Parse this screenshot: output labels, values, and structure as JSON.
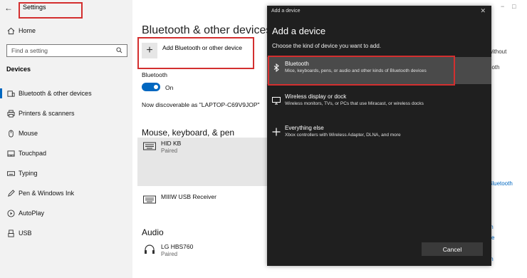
{
  "sidebar": {
    "back_glyph": "←",
    "app_title": "Settings",
    "home": {
      "label": "Home",
      "icon": "home-icon"
    },
    "search": {
      "placeholder": "Find a setting",
      "icon": "search-icon"
    },
    "section_title": "Devices",
    "items": [
      {
        "label": "Bluetooth & other devices",
        "icon": "bluetooth-devices-icon"
      },
      {
        "label": "Printers & scanners",
        "icon": "printer-icon"
      },
      {
        "label": "Mouse",
        "icon": "mouse-icon"
      },
      {
        "label": "Touchpad",
        "icon": "touchpad-icon"
      },
      {
        "label": "Typing",
        "icon": "keyboard-icon"
      },
      {
        "label": "Pen & Windows Ink",
        "icon": "pen-icon"
      },
      {
        "label": "AutoPlay",
        "icon": "autoplay-icon"
      },
      {
        "label": "USB",
        "icon": "usb-icon"
      }
    ]
  },
  "main": {
    "title": "Bluetooth & other devices",
    "add_device_label": "Add Bluetooth or other device",
    "bluetooth_label": "Bluetooth",
    "toggle_state": "On",
    "discoverable_text": "Now discoverable as \"LAPTOP-C69V9JOP\"",
    "sections": [
      {
        "title": "Mouse, keyboard, & pen",
        "devices": [
          {
            "name": "HID KB",
            "status": "Paired",
            "icon": "keyboard-icon"
          },
          {
            "name": "MIIIW USB Receiver",
            "status": "",
            "icon": "keyboard-icon"
          }
        ]
      },
      {
        "title": "Audio",
        "devices": [
          {
            "name": "LG HBS760",
            "status": "Paired",
            "icon": "headphones-icon"
          }
        ]
      }
    ],
    "right_fragments": [
      "without",
      "o",
      "ooth"
    ],
    "right_link_fragments": [
      "Bluetooth",
      "th",
      "ce",
      "th"
    ]
  },
  "dialog": {
    "window_title": "Add a device",
    "close_glyph": "✕",
    "heading": "Add a device",
    "subtitle": "Choose the kind of device you want to add.",
    "options": [
      {
        "title": "Bluetooth",
        "desc": "Mice, keyboards, pens, or audio and other kinds of Bluetooth devices",
        "icon": "bluetooth-icon"
      },
      {
        "title": "Wireless display or dock",
        "desc": "Wireless monitors, TVs, or PCs that use Miracast, or wireless docks",
        "icon": "monitor-icon"
      },
      {
        "title": "Everything else",
        "desc": "Xbox controllers with Wireless Adapter, DLNA, and more",
        "icon": "plus-icon"
      }
    ],
    "cancel_label": "Cancel"
  },
  "colors": {
    "accent": "#0067c0",
    "highlight_annotation": "#d32f2f",
    "dialog_bg": "#1f1f1f",
    "selected_option_bg": "#4a4a4a"
  }
}
